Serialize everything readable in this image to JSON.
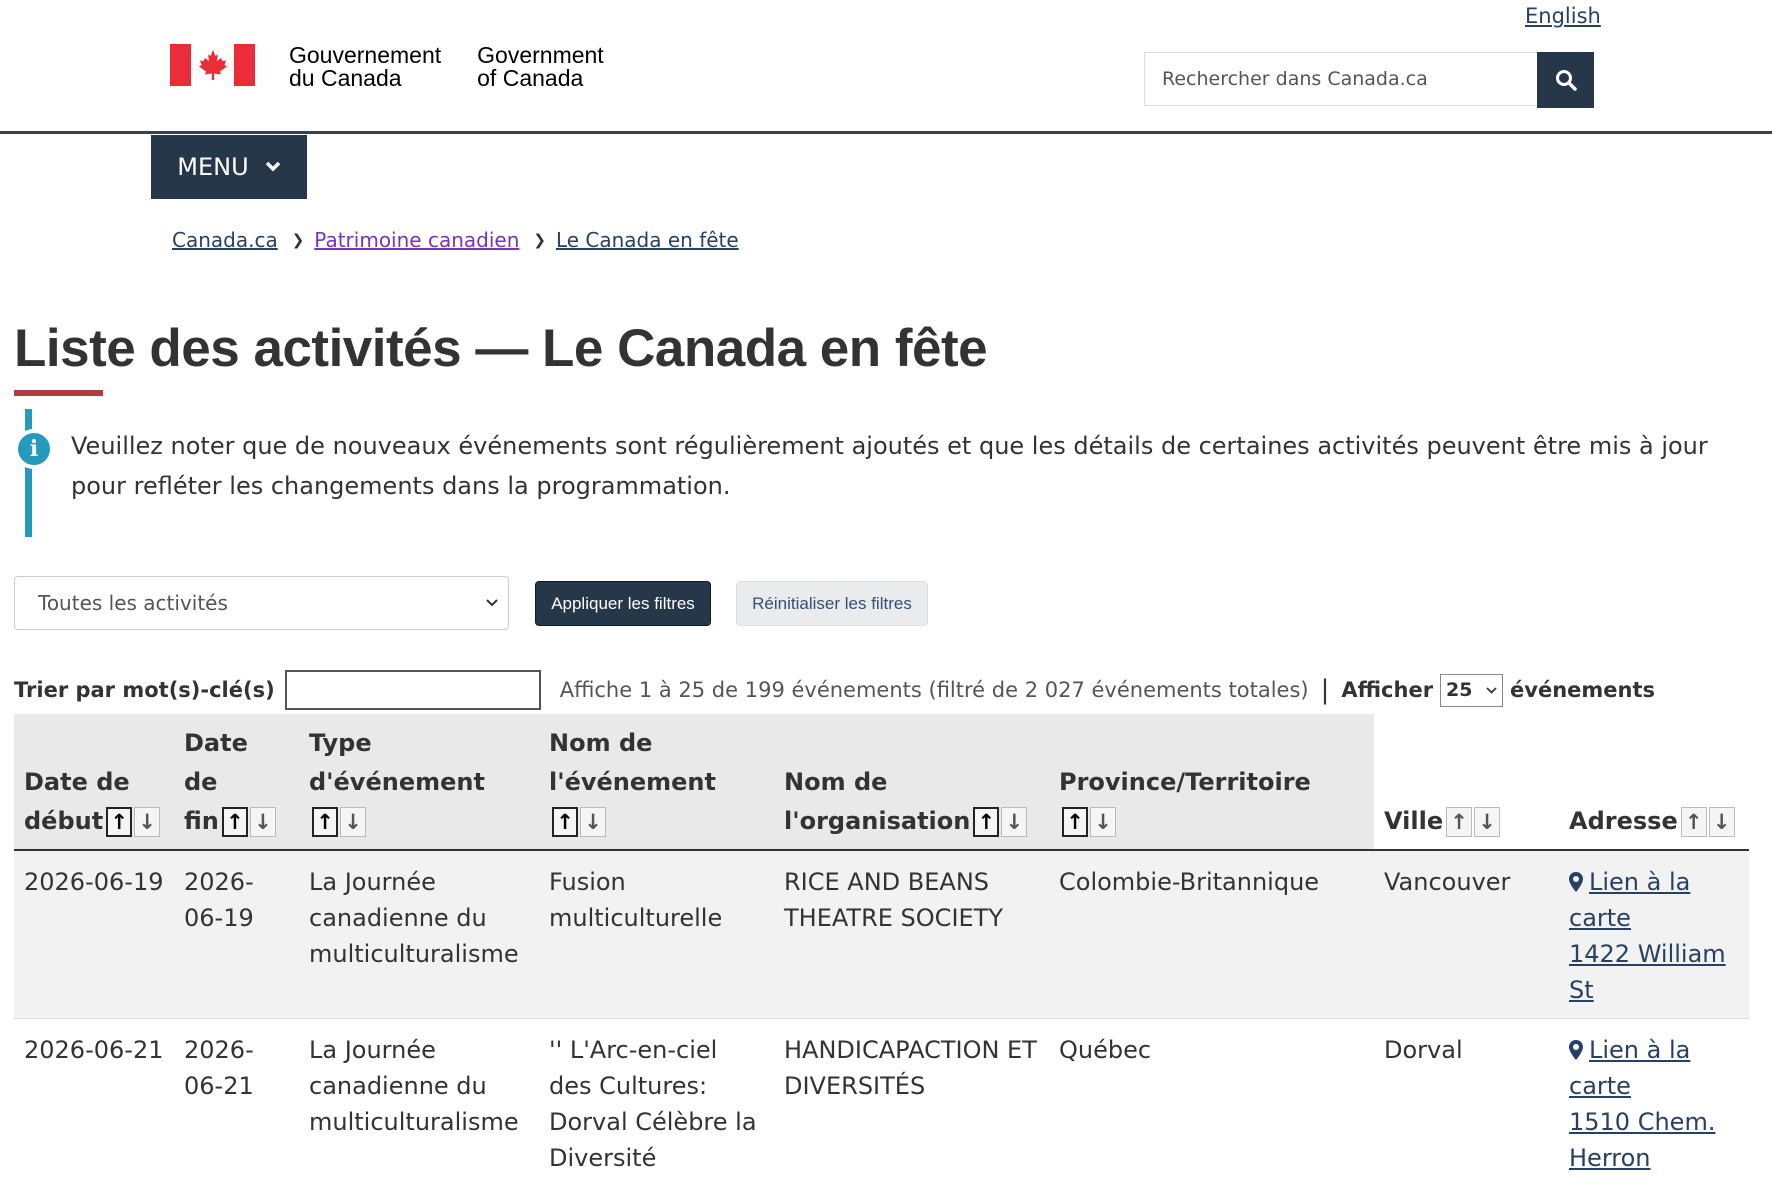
{
  "header": {
    "lang_link": "English",
    "brand_fr_line1": "Gouvernement",
    "brand_fr_line2": "du Canada",
    "brand_en_line1": "Government",
    "brand_en_line2": "of Canada",
    "search_placeholder": "Rechercher dans Canada.ca",
    "menu_label": "MENU",
    "colors": {
      "navy": "#26374a",
      "flag_red": "#eb2d37",
      "accent_red": "#af3c43",
      "info_blue": "#269abc"
    }
  },
  "breadcrumb": [
    "Canada.ca",
    "Patrimoine canadien",
    "Le Canada en fête"
  ],
  "page_title": "Liste des activités — Le Canada en fête",
  "alert_text": "Veuillez noter que de nouveaux événements sont régulièrement ajoutés et que les détails de certaines activités peuvent être mis à jour pour refléter les changements dans la programmation.",
  "filters": {
    "activity_select_value": "Toutes les activités",
    "apply_label": "Appliquer les filtres",
    "reset_label": "Réinitialiser les filtres",
    "keyword_label": "Trier par mot(s)-clé(s)",
    "info_text": "Affiche 1 à 25 de 199 événements (filtré de 2 027 événements totales)",
    "length_prefix": "Afficher",
    "length_value": "25",
    "length_suffix": "événements"
  },
  "table": {
    "columns": [
      {
        "line1": "Date de",
        "line2": "début"
      },
      {
        "line1": "Date de",
        "line2": "fin"
      },
      {
        "line1": "Type",
        "line2": "d'événement"
      },
      {
        "line1": "Nom de",
        "line2": "l'événement"
      },
      {
        "line1": "Nom de",
        "line2": "l'organisation"
      },
      {
        "line1": "",
        "line2": "Province/Territoire"
      },
      {
        "line1": "",
        "line2": "Ville"
      },
      {
        "line1": "",
        "line2": "Adresse"
      }
    ],
    "rows": [
      {
        "start": "2026-06-19",
        "end_1": "2026-",
        "end_2": "06-19",
        "type": "La Journée canadienne du multiculturalisme",
        "event": "Fusion multiculturelle",
        "org": "RICE AND BEANS THEATRE SOCIETY",
        "province": "Colombie-Britannique",
        "city": "Vancouver",
        "map_link": "Lien à la carte",
        "address": "1422 William St"
      },
      {
        "start": "2026-06-21",
        "end_1": "2026-",
        "end_2": "06-21",
        "type": "La Journée canadienne du multiculturalisme",
        "event": "'' L'Arc-en-ciel des Cultures: Dorval Célèbre la Diversité",
        "org": "HANDICAPACTION ET DIVERSITÉS",
        "province": "Québec",
        "city": "Dorval",
        "map_link": "Lien à la carte",
        "address": "1510 Chem. Herron"
      }
    ]
  }
}
